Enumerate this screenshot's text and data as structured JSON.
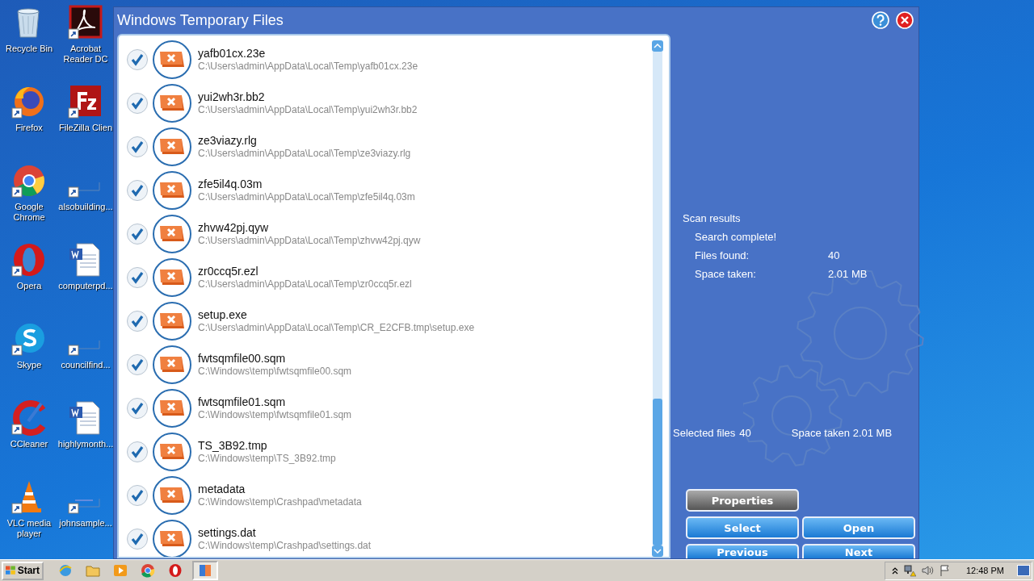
{
  "desktop": {
    "icons": [
      {
        "label": "Recycle Bin"
      },
      {
        "label": "Acrobat Reader DC"
      },
      {
        "label": "Firefox"
      },
      {
        "label": "FileZilla Clien"
      },
      {
        "label": "Google Chrome"
      },
      {
        "label": "alsobuilding..."
      },
      {
        "label": "Opera"
      },
      {
        "label": "computerpd..."
      },
      {
        "label": "Skype"
      },
      {
        "label": "councilfind..."
      },
      {
        "label": "CCleaner"
      },
      {
        "label": "highlymonth..."
      },
      {
        "label": "VLC media player"
      },
      {
        "label": "johnsample..."
      }
    ]
  },
  "window": {
    "title": "Windows Temporary Files",
    "files": [
      {
        "name": "yafb01cx.23e",
        "path": "C:\\Users\\admin\\AppData\\Local\\Temp\\yafb01cx.23e",
        "checked": true
      },
      {
        "name": "yui2wh3r.bb2",
        "path": "C:\\Users\\admin\\AppData\\Local\\Temp\\yui2wh3r.bb2",
        "checked": true
      },
      {
        "name": "ze3viazy.rlg",
        "path": "C:\\Users\\admin\\AppData\\Local\\Temp\\ze3viazy.rlg",
        "checked": true
      },
      {
        "name": "zfe5il4q.03m",
        "path": "C:\\Users\\admin\\AppData\\Local\\Temp\\zfe5il4q.03m",
        "checked": true
      },
      {
        "name": "zhvw42pj.qyw",
        "path": "C:\\Users\\admin\\AppData\\Local\\Temp\\zhvw42pj.qyw",
        "checked": true
      },
      {
        "name": "zr0ccq5r.ezl",
        "path": "C:\\Users\\admin\\AppData\\Local\\Temp\\zr0ccq5r.ezl",
        "checked": true
      },
      {
        "name": "setup.exe",
        "path": "C:\\Users\\admin\\AppData\\Local\\Temp\\CR_E2CFB.tmp\\setup.exe",
        "checked": true
      },
      {
        "name": "fwtsqmfile00.sqm",
        "path": "C:\\Windows\\temp\\fwtsqmfile00.sqm",
        "checked": true
      },
      {
        "name": "fwtsqmfile01.sqm",
        "path": "C:\\Windows\\temp\\fwtsqmfile01.sqm",
        "checked": true
      },
      {
        "name": "TS_3B92.tmp",
        "path": "C:\\Windows\\temp\\TS_3B92.tmp",
        "checked": true
      },
      {
        "name": "metadata",
        "path": "C:\\Windows\\temp\\Crashpad\\metadata",
        "checked": true
      },
      {
        "name": "settings.dat",
        "path": "C:\\Windows\\temp\\Crashpad\\settings.dat",
        "checked": true
      }
    ],
    "scan": {
      "heading": "Scan results",
      "status": "Search complete!",
      "stats": [
        {
          "label": "Files found:",
          "value": "40"
        },
        {
          "label": "Space taken:",
          "value": "2.01 MB"
        }
      ]
    },
    "selected": {
      "label": "Selected files",
      "value": "40",
      "space": "Space taken 2.01 MB"
    },
    "buttons": [
      {
        "label": "Properties",
        "disabled": true
      },
      {
        "label": "Select",
        "disabled": false
      },
      {
        "label": "Open",
        "disabled": false
      },
      {
        "label": "Previous",
        "disabled": false
      },
      {
        "label": "Next",
        "disabled": false
      }
    ]
  },
  "taskbar": {
    "start": "Start",
    "clock": "12:48 PM"
  }
}
